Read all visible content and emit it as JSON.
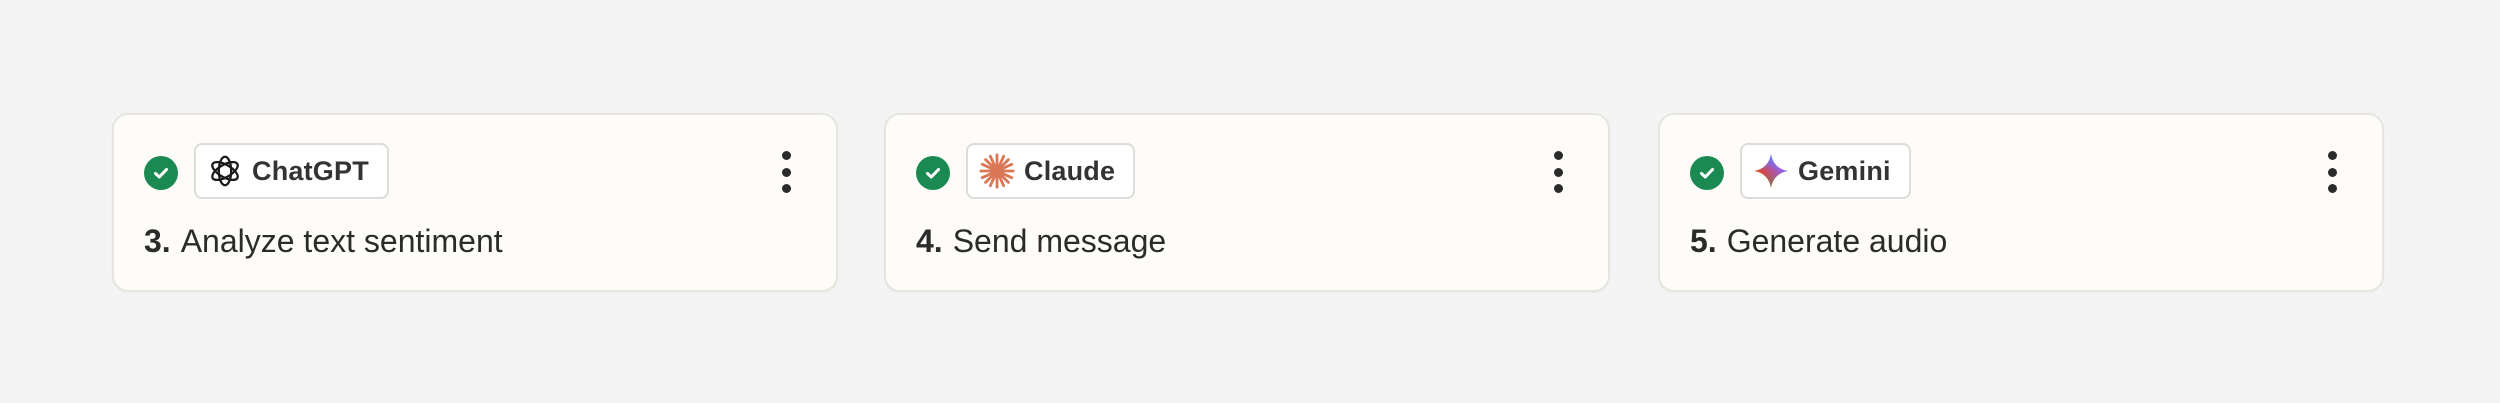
{
  "steps": [
    {
      "number": "3.",
      "title": "Analyze text sentiment",
      "app": "ChatGPT",
      "app_icon": "openai-logo-icon",
      "status": "complete",
      "status_color": "#1b8a52"
    },
    {
      "number": "4.",
      "title": "Send message",
      "app": "Claude",
      "app_icon": "claude-logo-icon",
      "status": "complete",
      "status_color": "#1b8a52",
      "icon_color": "#d97757"
    },
    {
      "number": "5.",
      "title": "Generate audio",
      "app": "Gemini",
      "app_icon": "gemini-logo-icon",
      "status": "complete",
      "status_color": "#1b8a52"
    }
  ],
  "colors": {
    "background": "#f4f4f4",
    "card": "#fdfcf8",
    "check": "#1b8a52",
    "text": "#2b2b2b"
  }
}
